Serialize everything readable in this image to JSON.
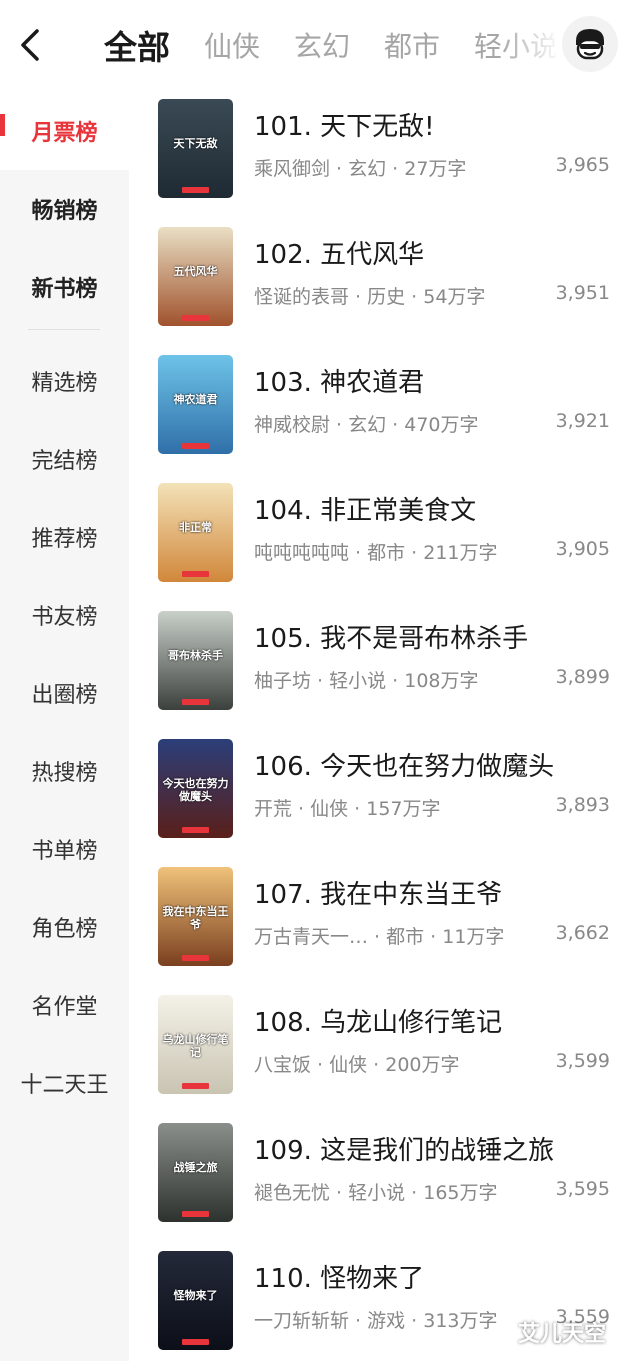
{
  "topbar": {
    "tabs": [
      "全部",
      "仙侠",
      "玄幻",
      "都市",
      "轻小说"
    ],
    "active_tab": 0
  },
  "sidebar": {
    "items": [
      {
        "label": "月票榜",
        "state": "active"
      },
      {
        "label": "畅销榜",
        "state": "bold"
      },
      {
        "label": "新书榜",
        "state": "bold"
      },
      {
        "label": "精选榜",
        "state": "normal"
      },
      {
        "label": "完结榜",
        "state": "normal"
      },
      {
        "label": "推荐榜",
        "state": "normal"
      },
      {
        "label": "书友榜",
        "state": "normal"
      },
      {
        "label": "出圈榜",
        "state": "normal"
      },
      {
        "label": "热搜榜",
        "state": "normal"
      },
      {
        "label": "书单榜",
        "state": "normal"
      },
      {
        "label": "角色榜",
        "state": "normal"
      },
      {
        "label": "名作堂",
        "state": "normal"
      },
      {
        "label": "十二天王",
        "state": "normal"
      }
    ]
  },
  "books": [
    {
      "title": "101. 天下无敌!",
      "meta": "乘风御剑 · 玄幻 · 27万字",
      "votes": "3,965",
      "cover_text": "天下无敌",
      "cover_colors": [
        "#3a4a55",
        "#1f2a33"
      ]
    },
    {
      "title": "102. 五代风华",
      "meta": "怪诞的表哥 · 历史 · 54万字",
      "votes": "3,951",
      "cover_text": "五代风华",
      "cover_colors": [
        "#e9dfc4",
        "#a0522d"
      ]
    },
    {
      "title": "103. 神农道君",
      "meta": "神威校尉 · 玄幻 · 470万字",
      "votes": "3,921",
      "cover_text": "神农道君",
      "cover_colors": [
        "#6ec3e8",
        "#2f6fa8"
      ]
    },
    {
      "title": "104. 非正常美食文",
      "meta": "吨吨吨吨吨 · 都市 · 211万字",
      "votes": "3,905",
      "cover_text": "非正常",
      "cover_colors": [
        "#f3e2b8",
        "#d1873a"
      ]
    },
    {
      "title": "105. 我不是哥布林杀手",
      "meta": "柚子坊 · 轻小说 · 108万字",
      "votes": "3,899",
      "cover_text": "哥布林杀手",
      "cover_colors": [
        "#c9cfc9",
        "#3b403c"
      ]
    },
    {
      "title": "106. 今天也在努力做魔头",
      "meta": "开荒 · 仙侠 · 157万字",
      "votes": "3,893",
      "cover_text": "今天也在努力做魔头",
      "cover_colors": [
        "#2b3f7a",
        "#5a1f1a"
      ]
    },
    {
      "title": "107. 我在中东当王爷",
      "meta": "万古青天一… · 都市 · 11万字",
      "votes": "3,662",
      "cover_text": "我在中东当王爷",
      "cover_colors": [
        "#f0c27a",
        "#7a3f1f"
      ]
    },
    {
      "title": "108. 乌龙山修行笔记",
      "meta": "八宝饭 · 仙侠 · 200万字",
      "votes": "3,599",
      "cover_text": "乌龙山修行笔记",
      "cover_colors": [
        "#f4f1e8",
        "#c9c4b2"
      ]
    },
    {
      "title": "109. 这是我们的战锤之旅",
      "meta": "褪色无忧 · 轻小说 · 165万字",
      "votes": "3,595",
      "cover_text": "战锤之旅",
      "cover_colors": [
        "#8a8f8c",
        "#2e322f"
      ]
    },
    {
      "title": "110. 怪物来了",
      "meta": "一刀斩斩斩 · 游戏 · 313万字",
      "votes": "3,559",
      "cover_text": "怪物来了",
      "cover_colors": [
        "#24293a",
        "#0c0f18"
      ]
    }
  ],
  "watermark": "艾儿天空",
  "colors": {
    "accent": "#e8343b"
  }
}
